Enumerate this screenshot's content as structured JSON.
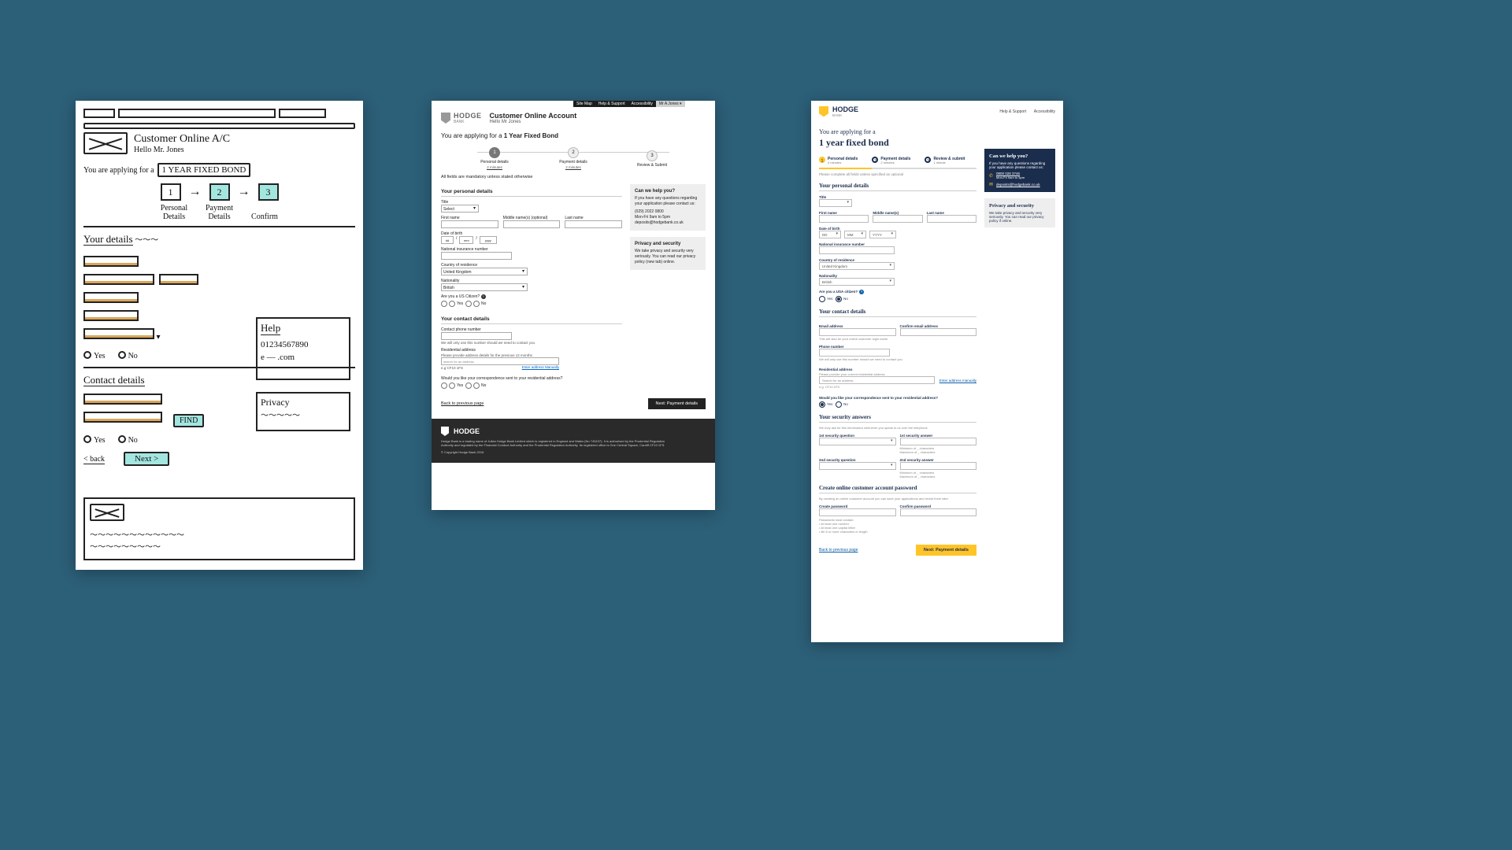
{
  "sketch": {
    "header_title": "Customer Online A/C",
    "header_sub": "Hello Mr. Jones",
    "you_are": "You are applying for a",
    "product": "1 YEAR FIXED BOND",
    "steps": [
      {
        "n": "1",
        "label": "Personal Details"
      },
      {
        "n": "2",
        "label": "Payment Details"
      },
      {
        "n": "3",
        "label": "Confirm"
      }
    ],
    "your_details": "Your details",
    "help_title": "Help",
    "help_phone": "01234567890",
    "help_email": "e — .com",
    "privacy_title": "Privacy",
    "yes": "Yes",
    "no": "No",
    "contact_details": "Contact details",
    "find": "FIND",
    "back": "< back",
    "next": "Next  >"
  },
  "v1": {
    "topbar": {
      "sitemap": "Site Map",
      "help": "Help & Support",
      "access": "Accessibility",
      "user": "Mr A Jones ▾"
    },
    "brand": "HODGE",
    "brand_sub": "BANK",
    "title": "Customer Online Account",
    "hello": "Hello Mr Jones",
    "you_are": "You are applying for a",
    "product": "1 Year Fixed Bond",
    "steps": [
      {
        "n": "1",
        "label": "Personal details",
        "dur": "2 minutes"
      },
      {
        "n": "2",
        "label": "Payment details",
        "dur": "2 minutes"
      },
      {
        "n": "3",
        "label": "Review & Submit",
        "dur": ""
      }
    ],
    "mandatory_note": "All fields are mandatory unless stated otherwise",
    "sect_personal": "Your personal details",
    "lbl_title": "Title",
    "title_val": "Select",
    "lbl_first": "First name",
    "lbl_middle": "Middle name(s) (optional)",
    "lbl_last": "Last name",
    "lbl_dob": "Date of birth",
    "dob_dd": "dd",
    "dob_mm": "mm",
    "dob_yy": "yyyy",
    "lbl_ni": "National insurance number",
    "lbl_country": "Country of residence",
    "country_val": "United Kingdom",
    "lbl_nat": "Nationality",
    "nat_val": "British",
    "lbl_us": "Are you a US Citizen?",
    "sect_contact": "Your contact details",
    "lbl_phone": "Contact phone number",
    "phone_note": "We will only use this number should we need to contact you",
    "lbl_res": "Residential address",
    "res_note": "Please provide address details for the previous 12 months",
    "res_placeholder": "search for an address",
    "res_eg": "e.g CF10 1FS",
    "res_manual": "Enter address Manually",
    "lbl_correspond": "Would you like your correspondence sent to your residential address?",
    "yes": "Yes",
    "no": "No",
    "help_title": "Can we help you?",
    "help_body1": "If you have any questions regarding your application please contact us:",
    "help_phone": "(029) 2022 0800",
    "help_hours": "Mon-Fri 9am to 5pm",
    "help_email": "deposits@hodgebank.co.uk",
    "priv_title": "Privacy and security",
    "priv_body": "We take privacy and security very seriously. You can read our privacy policy (new tab) online.",
    "nav_back": "Back to previous page",
    "nav_next": "Next: Payment details",
    "footer_brand": "HODGE",
    "footer_body": "Hodge Bank is a trading name of Julian Hodge Bank Limited which is registered in England and Wales (No 743437). It is authorised by the Prudential Regulation Authority and regulated by the Financial Conduct Authority and the Prudential Regulation Authority. Its registered office is One Central Square, Cardiff CF10 1FS.",
    "footer_copy": "© Copyright Hodge Bank 2016"
  },
  "v2": {
    "brand": "HODGE",
    "brand_sub": "BANK",
    "hdr_help": "Help & Support",
    "hdr_access": "Accessibility",
    "you_are": "You are applying for a",
    "product": "1 year fixed bond",
    "steps": [
      {
        "n": "1",
        "label": "Personal details",
        "dur": "4 minutes"
      },
      {
        "n": "2",
        "label": "Payment details",
        "dur": "2 minutes"
      },
      {
        "n": "3",
        "label": "Review & submit",
        "dur": "1 minute"
      }
    ],
    "instruct": "Please complete all fields unless specified as optional",
    "sect_personal": "Your personal details",
    "lbl_title": "Title",
    "lbl_first": "First name",
    "lbl_middle": "Middle name(s)",
    "lbl_last": "Last name",
    "lbl_dob": "Date of birth",
    "dob_dd": "DD",
    "dob_mm": "MM",
    "dob_yy": "YYYY",
    "lbl_ni": "National insurance number",
    "lbl_country": "Country of residence",
    "country_val": "United Kingdom",
    "lbl_nat": "Nationality",
    "nat_val": "British",
    "lbl_us": "Are you a USA citizen?",
    "yes": "Yes",
    "no": "No",
    "sect_contact": "Your contact details",
    "lbl_email": "Email address",
    "lbl_cemail": "Confirm email address",
    "email_note": "This will also be your online customer login name",
    "lbl_phone": "Phone number",
    "phone_note": "We will only use this number should we need to contact you",
    "lbl_res": "Residential address",
    "res_note": "Please provide your current residential address",
    "res_placeholder": "Search for an address",
    "res_eg": "e.g. CF10 1FS",
    "res_manual": "Enter address manually",
    "lbl_correspond": "Would you like your correspondence sent to your residential address?",
    "sect_security": "Your security answers",
    "sec_note": "We may ask for this information whenever you speak to us over the telephone",
    "lbl_q1": "1st security question",
    "lbl_a1": "1st security answer",
    "lbl_q2": "2nd security question",
    "lbl_a2": "2nd security answer",
    "ans_hint1": "Minimum of _ characters",
    "ans_hint2": "Maximum of _ characters",
    "sect_password": "Create online customer account password",
    "pw_note": "By creating an online customer account you can save your applications and revisit them later",
    "lbl_pw": "Create password",
    "lbl_cpw": "Confirm password",
    "pw_rules_h": "Passwords must contain:",
    "pw_rule1": "• At least one number",
    "pw_rule2": "• At least one capital letter",
    "pw_rule3": "• Be 8 or more characters in length",
    "nav_back": "Back to previous page",
    "nav_next": "Next: Payment details",
    "help_title": "Can we help you?",
    "help_body": "If you have any questions regarding your application please contact us:",
    "help_phone": "0800 028 3746",
    "help_hours": "Mon-Fri 9am to 5pm",
    "help_email": "deposits@hodgebank.co.uk",
    "priv_title": "Privacy and security",
    "priv_body": "We take privacy and security very seriously. You can read our privacy policy if online."
  }
}
